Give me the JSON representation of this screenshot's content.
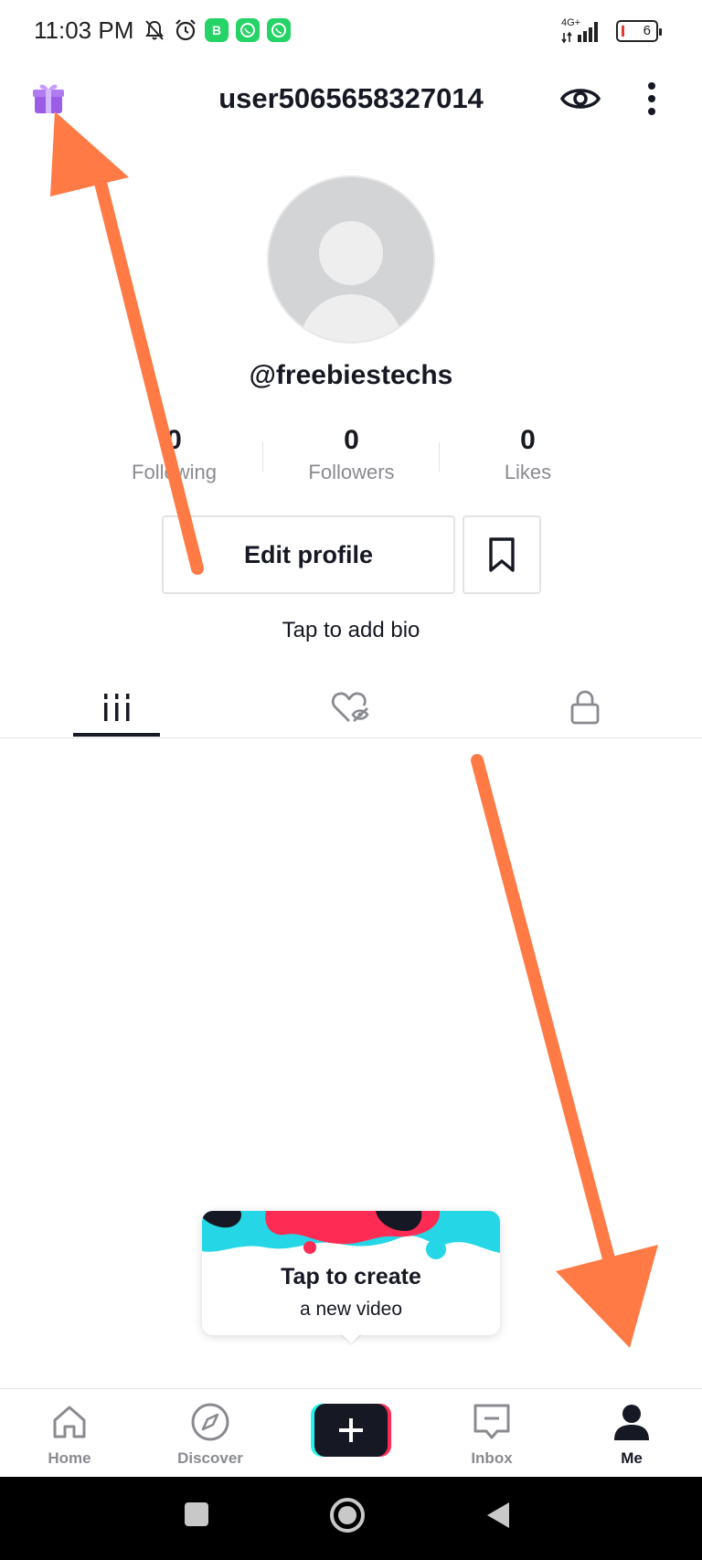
{
  "status_bar": {
    "time": "11:03 PM",
    "network": "4G+",
    "battery": "6"
  },
  "header": {
    "username": "user5065658327014",
    "icons": [
      "gift-icon",
      "eye-icon",
      "more-vertical-icon"
    ]
  },
  "profile": {
    "handle": "@freebiestechs",
    "stats": [
      {
        "value": "0",
        "label": "Following"
      },
      {
        "value": "0",
        "label": "Followers"
      },
      {
        "value": "0",
        "label": "Likes"
      }
    ],
    "edit_label": "Edit profile",
    "bio_placeholder": "Tap to add bio"
  },
  "tabs": [
    {
      "icon": "videos-grid-icon",
      "active": true
    },
    {
      "icon": "liked-hidden-icon",
      "active": false
    },
    {
      "icon": "private-lock-icon",
      "active": false
    }
  ],
  "tooltip": {
    "title": "Tap to create",
    "subtitle": "a new video"
  },
  "bottom_nav": [
    {
      "label": "Home",
      "icon": "home-icon",
      "active": false
    },
    {
      "label": "Discover",
      "icon": "compass-icon",
      "active": false
    },
    {
      "label": "",
      "icon": "create-plus-icon",
      "active": false
    },
    {
      "label": "Inbox",
      "icon": "inbox-icon",
      "active": false
    },
    {
      "label": "Me",
      "icon": "person-icon",
      "active": true
    }
  ],
  "colors": {
    "text": "#161823",
    "muted": "#8a8b91",
    "arrow": "#ff7a45",
    "tiktok_cyan": "#25f4ee",
    "tiktok_red": "#fe2c55"
  }
}
